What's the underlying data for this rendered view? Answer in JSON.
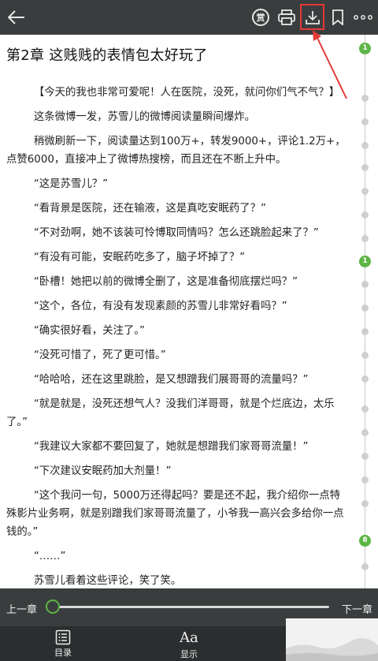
{
  "topbar": {
    "reward_label": "赏",
    "icons": [
      "back-arrow-icon",
      "reward-icon",
      "printer-icon",
      "download-icon",
      "bookmark-icon",
      "more-icon"
    ]
  },
  "chapter": {
    "title": "第2章 这贱贱的表情包太好玩了",
    "paragraphs": [
      "【今天的我也非常可爱呢！人在医院，没死，就问你们气不气？】",
      "这条微博一发，苏雪儿的微博阅读量瞬间爆炸。",
      "稍微刷新一下，阅读量达到100万+，转发9000+，评论1.2万+，点赞6000，直接冲上了微博热搜榜，而且还在不断上升中。",
      "“这是苏雪儿？”",
      "“看背景是医院，还在输液，这是真吃安眠药了？”",
      "“不对劲啊，她不该装可怜博取同情吗？怎么还跳脸起来了？”",
      "“有没有可能，安眠药吃多了，脑子坏掉了？”",
      "“卧槽！她把以前的微博全删了，这是准备彻底摆烂吗？”",
      "“这个，各位，有没有发现素颜的苏雪儿非常好看吗？”",
      "“确实很好看，关注了。”",
      "“没死可惜了，死了更可惜。”",
      "“哈哈哈，还在这里跳脸，是又想蹭我们展哥哥的流量吗？”",
      "“就是就是，没死还想气人？没我们洋哥哥，就是个烂底边，太乐了。”",
      "“我建议大家都不要回复了，她就是想蹭我们家哥哥流量！”",
      "“下次建议安眠药加大剂量！”",
      "“这个我问一句，5000万还得起吗？要是还不起，我介绍你一点特殊影片业务啊，就是别蹭我们家哥哥流量了，小爷我一高兴会多给你一点钱的。”",
      "“……”",
      "苏雪儿看着这些评论，笑了笑。"
    ]
  },
  "timeline": {
    "badges": [
      "1",
      "1",
      "8"
    ]
  },
  "chapter_nav": {
    "prev_label": "上一章",
    "next_label": "下一章",
    "progress": 0
  },
  "bottom_nav": {
    "toc_label": "目录",
    "display_label": "显示",
    "display_icon_text": "Aa"
  },
  "colors": {
    "bar": "#3a3d3e",
    "accent_green": "#5cb544",
    "highlight_red": "#e53935"
  }
}
